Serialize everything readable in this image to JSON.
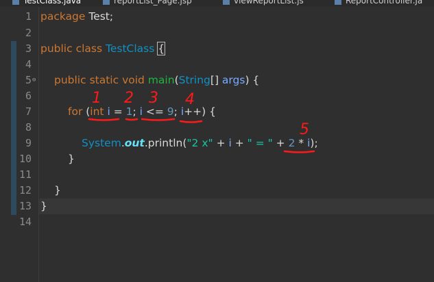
{
  "tabs": [
    {
      "label": "TestClass.java",
      "active": true
    },
    {
      "label": "reportList_Page.jsp",
      "active": false
    },
    {
      "label": "viewReportList.js",
      "active": false
    },
    {
      "label": "ReportController.ja",
      "active": false
    }
  ],
  "line_numbers": [
    "1",
    "2",
    "3",
    "4",
    "5",
    "6",
    "7",
    "8",
    "9",
    "10",
    "11",
    "12",
    "13",
    "14"
  ],
  "code": {
    "l1": {
      "kw": "package",
      "rest": " Test;"
    },
    "l3": {
      "kw1": "public",
      "kw2": "class",
      "cls": "TestClass",
      "brace": "{"
    },
    "l5": {
      "kw1": "public",
      "kw2": "static",
      "kw3": "void",
      "fn": "main",
      "p1": "(",
      "cls": "String",
      "p2": "[] ",
      "var": "args",
      "p3": ") {"
    },
    "l7": {
      "kw": "for",
      "p1": " (",
      "kw2": "int",
      "sp1": " ",
      "v1": "i",
      "p2": " = ",
      "n1": "1",
      "p3": "; ",
      "v2": "i",
      "p4": " <= ",
      "n2": "9",
      "p5": "; ",
      "v3": "i",
      "p6": "++) {"
    },
    "l9": {
      "cls": "System",
      "dot1": ".",
      "fld": "out",
      "dot2": ".",
      "m": "println",
      "p1": "(",
      "s1": "\"2 x\"",
      "p2": " + ",
      "v1": "i",
      "p3": " + ",
      "s2": "\" = \"",
      "p4": " + ",
      "n1": "2",
      "p5": " * ",
      "v2": "i",
      "p6": ");"
    },
    "l10": {
      "text": "}"
    },
    "l12": {
      "text": "}"
    },
    "l13": {
      "text": "}"
    }
  },
  "annotations": {
    "markers": [
      "1",
      "2",
      "3",
      "4",
      "5"
    ],
    "color": "#ff1a1a"
  },
  "colors": {
    "background": "#2f2f2f",
    "keyword": "#cc7832",
    "class": "#1290c3",
    "method": "#1eb540",
    "variable": "#79abff",
    "string": "#17c6a3",
    "annotation": "#ff1a1a"
  }
}
